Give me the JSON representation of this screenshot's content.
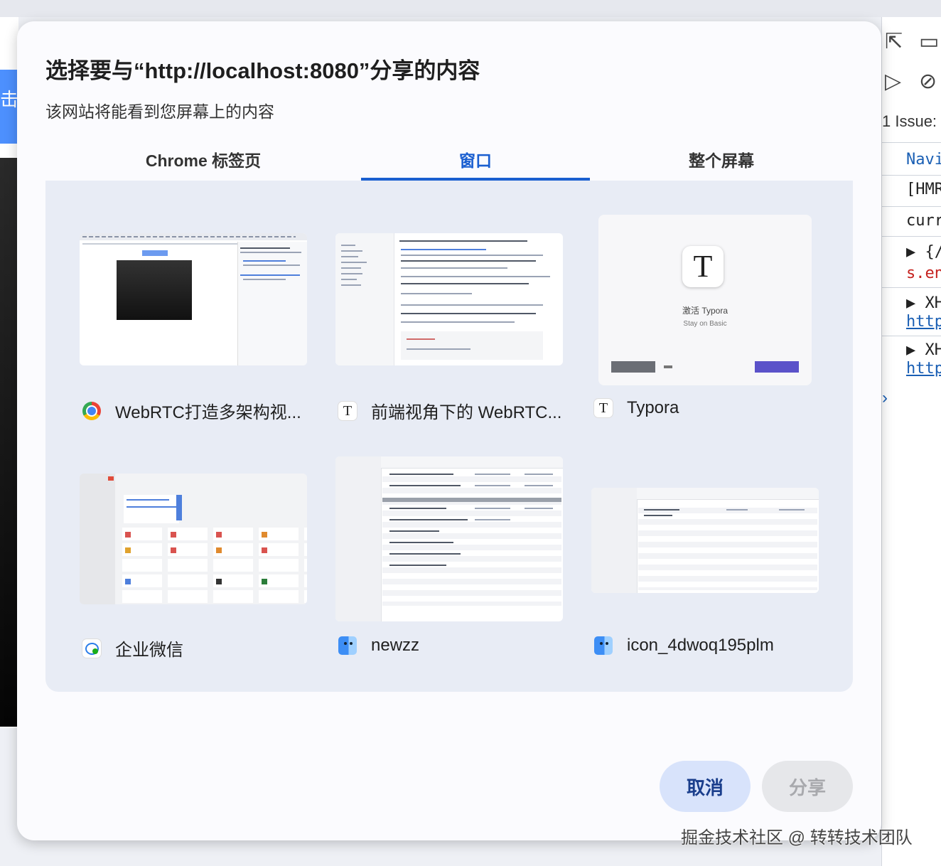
{
  "dialog": {
    "title": "选择要与“http://localhost:8080”分享的内容",
    "subtitle": "该网站将能看到您屏幕上的内容",
    "tabs": [
      {
        "label": "Chrome 标签页",
        "active": false
      },
      {
        "label": "窗口",
        "active": true
      },
      {
        "label": "整个屏幕",
        "active": false
      }
    ],
    "windows": [
      {
        "label": "WebRTC打造多架构视...",
        "icon": "chrome-icon"
      },
      {
        "label": "前端视角下的 WebRTC...",
        "icon": "typora-icon"
      },
      {
        "label": "Typora",
        "icon": "typora-icon"
      },
      {
        "label": "企业微信",
        "icon": "wecom-icon"
      },
      {
        "label": "newzz",
        "icon": "finder-icon"
      },
      {
        "label": "icon_4dwoq195plm",
        "icon": "finder-icon"
      }
    ],
    "typora_preview": {
      "logo": "T",
      "line1": "激活 Typora",
      "line2": "Stay on Basic"
    },
    "buttons": {
      "cancel": "取消",
      "share": "分享"
    },
    "colors": {
      "accent": "#1a5fd0",
      "cancel_bg": "#d8e3fb",
      "panel_bg": "#e8ecf5"
    }
  },
  "background": {
    "left_char": "击",
    "devtools": {
      "issues": "1 Issue:",
      "rows": [
        "Navi",
        "[HMR",
        "curr",
        "▶ {/",
        "s.en",
        "▶ XH",
        "http",
        "▶ XH",
        "http"
      ]
    }
  },
  "watermark": "掘金技术社区 @ 转转技术团队"
}
